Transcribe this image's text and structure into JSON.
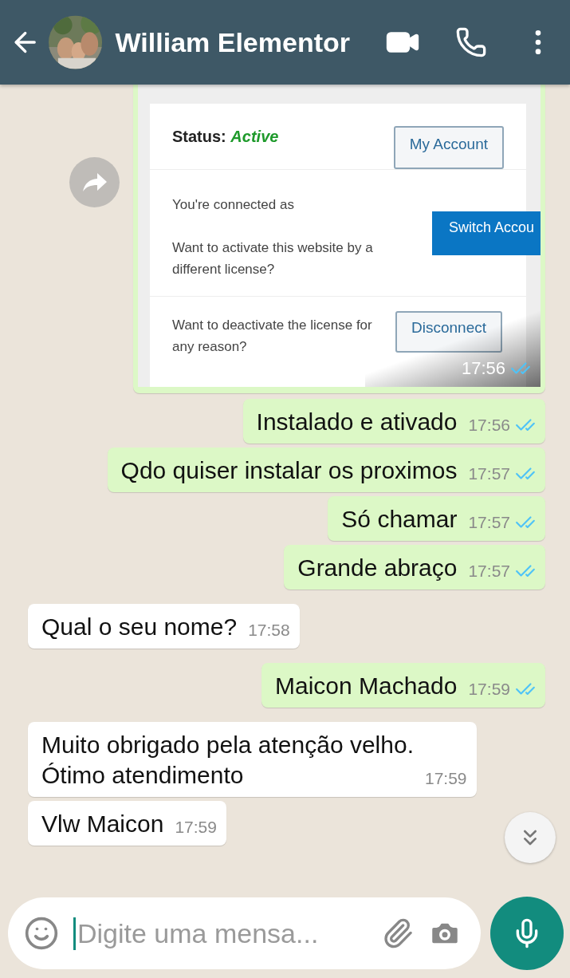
{
  "header": {
    "contact_name": "William Elementor"
  },
  "image_message": {
    "status_label": "Status:",
    "status_value": "Active",
    "my_account": "My Account",
    "connected_as": "You're connected as",
    "activate_text": "Want to activate this website by a different license?",
    "switch_button": "Switch Accou",
    "deactivate_text": "Want to deactivate the license for any reason?",
    "disconnect": "Disconnect",
    "time": "17:56",
    "read": true
  },
  "messages": [
    {
      "kind": "outgoing",
      "text": "Instalado e ativado",
      "time": "17:56",
      "read": true
    },
    {
      "kind": "outgoing",
      "text": "Qdo quiser instalar os proximos",
      "time": "17:57",
      "read": true
    },
    {
      "kind": "outgoing",
      "text": "Só chamar",
      "time": "17:57",
      "read": true
    },
    {
      "kind": "outgoing",
      "text": "Grande abraço",
      "time": "17:57",
      "read": true
    },
    {
      "kind": "incoming",
      "text": "Qual o seu nome?",
      "time": "17:58"
    },
    {
      "kind": "outgoing",
      "text": "Maicon Machado",
      "time": "17:59",
      "read": true
    },
    {
      "kind": "incoming",
      "text": "Muito obrigado pela atenção velho.\nÓtimo atendimento",
      "time": "17:59"
    },
    {
      "kind": "incoming",
      "text": "Vlw Maicon",
      "time": "17:59"
    }
  ],
  "composer": {
    "placeholder": "Digite uma mensa..."
  }
}
